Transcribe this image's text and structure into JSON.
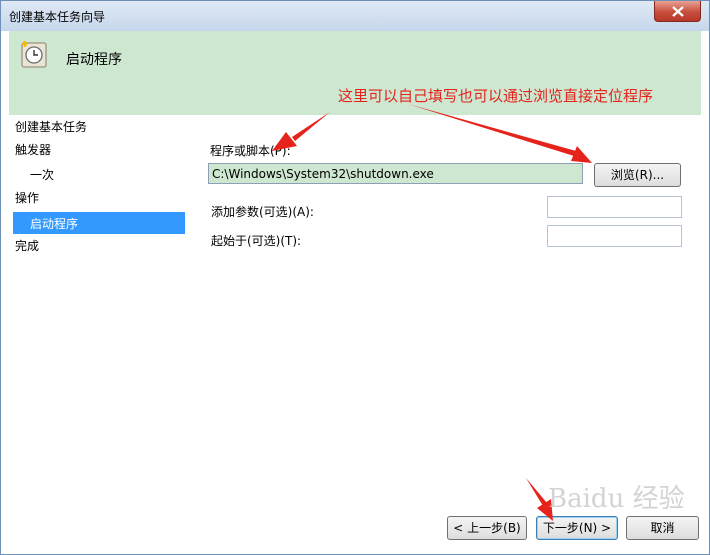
{
  "window": {
    "title": "创建基本任务向导"
  },
  "banner": {
    "title": "启动程序",
    "icon": "clock-task-icon"
  },
  "steps": [
    {
      "label": "创建基本任务"
    },
    {
      "label": "触发器"
    },
    {
      "label": "一次"
    },
    {
      "label": "操作"
    },
    {
      "label": "启动程序"
    },
    {
      "label": "完成"
    }
  ],
  "form": {
    "program_label": "程序或脚本(P):",
    "program_value": "C:\\Windows\\System32\\shutdown.exe",
    "browse_label": "浏览(R)...",
    "args_label": "添加参数(可选)(A):",
    "args_value": "",
    "start_in_label": "起始于(可选)(T):",
    "start_in_value": ""
  },
  "footer": {
    "back_label": "< 上一步(B)",
    "next_label": "下一步(N) >",
    "cancel_label": "取消"
  },
  "annotation": {
    "text": "这里可以自己填写也可以通过浏览直接定位程序",
    "color": "#e5231b"
  },
  "watermark": {
    "text": "Baidu 经验"
  }
}
